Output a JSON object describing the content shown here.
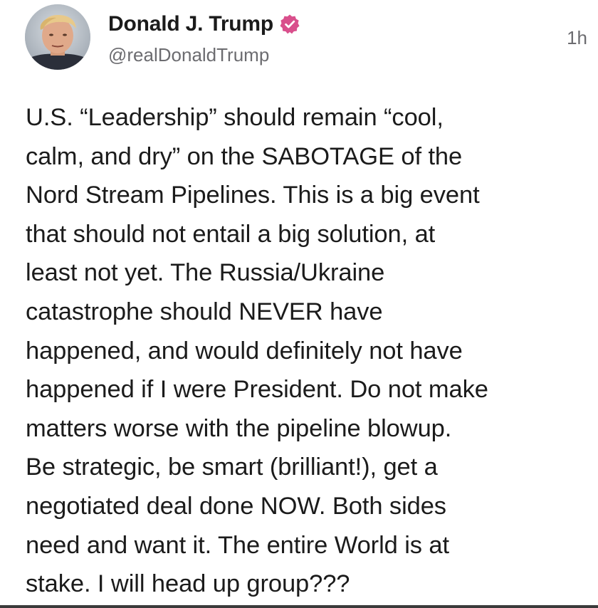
{
  "post": {
    "author": {
      "display_name": "Donald J. Trump",
      "handle": "@realDonaldTrump",
      "verified_icon": "verified-badge-icon",
      "avatar_icon": "avatar"
    },
    "timestamp": "1h",
    "text": "U.S. “Leadership” should remain “cool,\ncalm, and dry” on the SABOTAGE of the\nNord Stream Pipelines. This is a big event\nthat should not entail a big solution, at\nleast not yet. The Russia/Ukraine\ncatastrophe should NEVER have\nhappened, and would definitely not have\nhappened if I were President. Do not make\nmatters worse with the pipeline blowup.\nBe strategic, be smart (brilliant!), get a\nnegotiated deal done NOW. Both sides\nneed and want it. The entire World is at\nstake. I will head up group???"
  },
  "colors": {
    "verified_badge": "#d94f8c",
    "text": "#1b1b1b",
    "secondary_text": "#6c6c70",
    "background": "#ffffff"
  }
}
